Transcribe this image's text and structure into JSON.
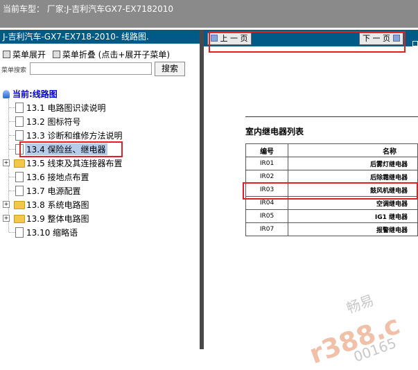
{
  "header": {
    "title": "当前车型： 厂家:J-吉利汽车GX7-EX7182010"
  },
  "left": {
    "panel_title": "J-吉利汽车-GX7-EX718-2010- 线路图.",
    "expand_label": "菜单展开",
    "collapse_label": "菜单折叠 (点击+展开子菜单)",
    "search_label": "菜单搜索",
    "search_button": "搜索",
    "root_label": "当前:线路图",
    "items": [
      {
        "label": "13.1 电路图识读说明"
      },
      {
        "label": "13.2 图标符号"
      },
      {
        "label": "13.3 诊断和维修方法说明"
      },
      {
        "label": "13.4 保险丝、继电器"
      },
      {
        "label": "13.5 线束及其连接器布置"
      },
      {
        "label": "13.6 接地点布置"
      },
      {
        "label": "13.7 电源配置"
      },
      {
        "label": "13.8 系统电路图"
      },
      {
        "label": "13.9 整体电路图"
      },
      {
        "label": "13.10 缩略语"
      }
    ]
  },
  "right": {
    "prev_label": "上 一 页",
    "next_label": "下 一 页",
    "table_title": "室内继电器列表",
    "columns": [
      "编号",
      "名称"
    ],
    "rows": [
      {
        "id": "IR01",
        "name": "后雾灯继电器"
      },
      {
        "id": "IR02",
        "name": "后除霜继电器"
      },
      {
        "id": "IR03",
        "name": "鼓风机继电器"
      },
      {
        "id": "IR04",
        "name": "空调继电器"
      },
      {
        "id": "IR05",
        "name": "IG1 继电器"
      },
      {
        "id": "IR07",
        "name": "报警继电器"
      }
    ]
  },
  "watermark": {
    "text1": "畅易",
    "text2": "r388.c",
    "text3": "00165"
  }
}
